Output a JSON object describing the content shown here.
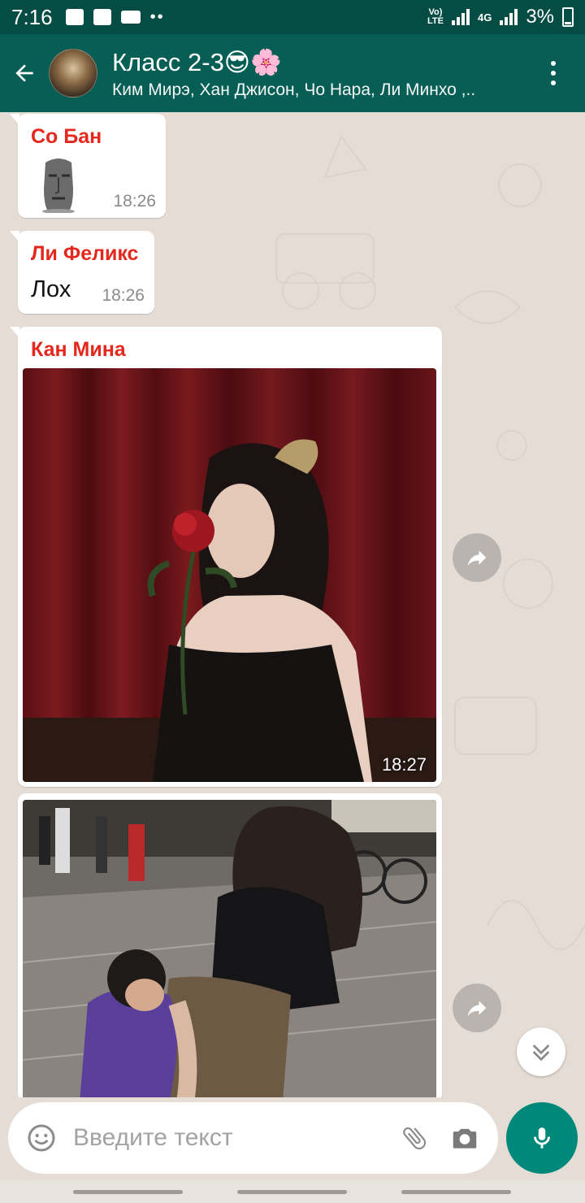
{
  "status_bar": {
    "time": "7:16",
    "network_label": "Vo) LTE",
    "network_type": "4G",
    "battery": "3%"
  },
  "header": {
    "title": "Класс 2-3😎🌸",
    "participants": "Ким Мирэ, Хан Джисон, Чо Нара, Ли Минхо ,..",
    "back_icon": "arrow-left-icon",
    "menu_icon": "more-vertical-icon",
    "colors": {
      "status_bar": "#054d44",
      "header": "#075e54"
    }
  },
  "messages": [
    {
      "sender": "Со Бан",
      "type": "sticker",
      "sticker": "moai-emoji",
      "time": "18:26"
    },
    {
      "sender": "Ли Феликс",
      "type": "text",
      "text": "Лох",
      "time": "18:26"
    },
    {
      "sender": "Кан Мина",
      "type": "image",
      "image": "girl-with-red-rose-photo",
      "time": "18:27"
    },
    {
      "sender": "",
      "type": "image",
      "image": "street-photo",
      "time": ""
    }
  ],
  "sender_color": "#e5281d",
  "input": {
    "placeholder": "Введите текст",
    "emoji_icon": "emoji-icon",
    "attach_icon": "paperclip-icon",
    "camera_icon": "camera-icon",
    "mic_icon": "microphone-icon",
    "accent": "#00897b"
  }
}
